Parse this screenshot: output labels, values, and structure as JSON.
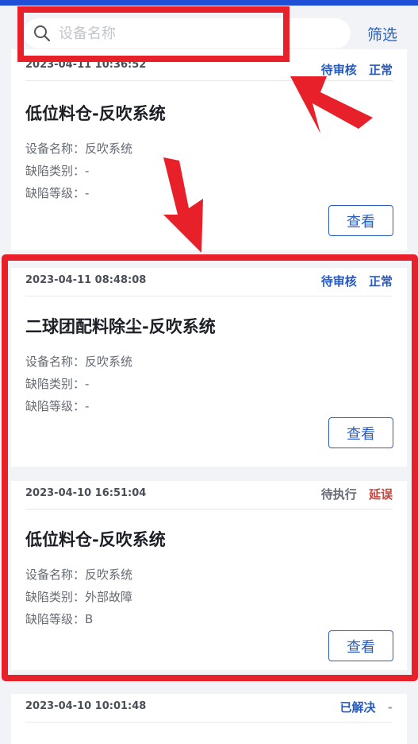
{
  "search": {
    "placeholder": "设备名称",
    "filter_label": "筛选"
  },
  "cards": [
    {
      "time": "2023-04-11 10:36:52",
      "status": "待审核",
      "level_status": "正常",
      "title": "低位料仓-反吹系统",
      "name_label": "设备名称：",
      "name_value": "反吹系统",
      "type_label": "缺陷类别：",
      "type_value": "-",
      "grade_label": "缺陷等级：",
      "grade_value": "-",
      "view_label": "查看"
    },
    {
      "time": "2023-04-11 08:48:08",
      "status": "待审核",
      "level_status": "正常",
      "title": "二球团配料除尘-反吹系统",
      "name_label": "设备名称：",
      "name_value": "反吹系统",
      "type_label": "缺陷类别：",
      "type_value": "-",
      "grade_label": "缺陷等级：",
      "grade_value": "-",
      "view_label": "查看"
    },
    {
      "time": "2023-04-10 16:51:04",
      "status": "待执行",
      "level_status": "延误",
      "title": "低位料仓-反吹系统",
      "name_label": "设备名称：",
      "name_value": "反吹系统",
      "type_label": "缺陷类别：",
      "type_value": "外部故障",
      "grade_label": "缺陷等级：",
      "grade_value": "B",
      "view_label": "查看"
    },
    {
      "time": "2023-04-10 10:01:48",
      "status": "已解决",
      "level_status": "-"
    }
  ],
  "colors": {
    "accent": "#2559c4",
    "delay": "#c8423a",
    "annotation": "#e8202a",
    "background": "#f1f3f7"
  }
}
